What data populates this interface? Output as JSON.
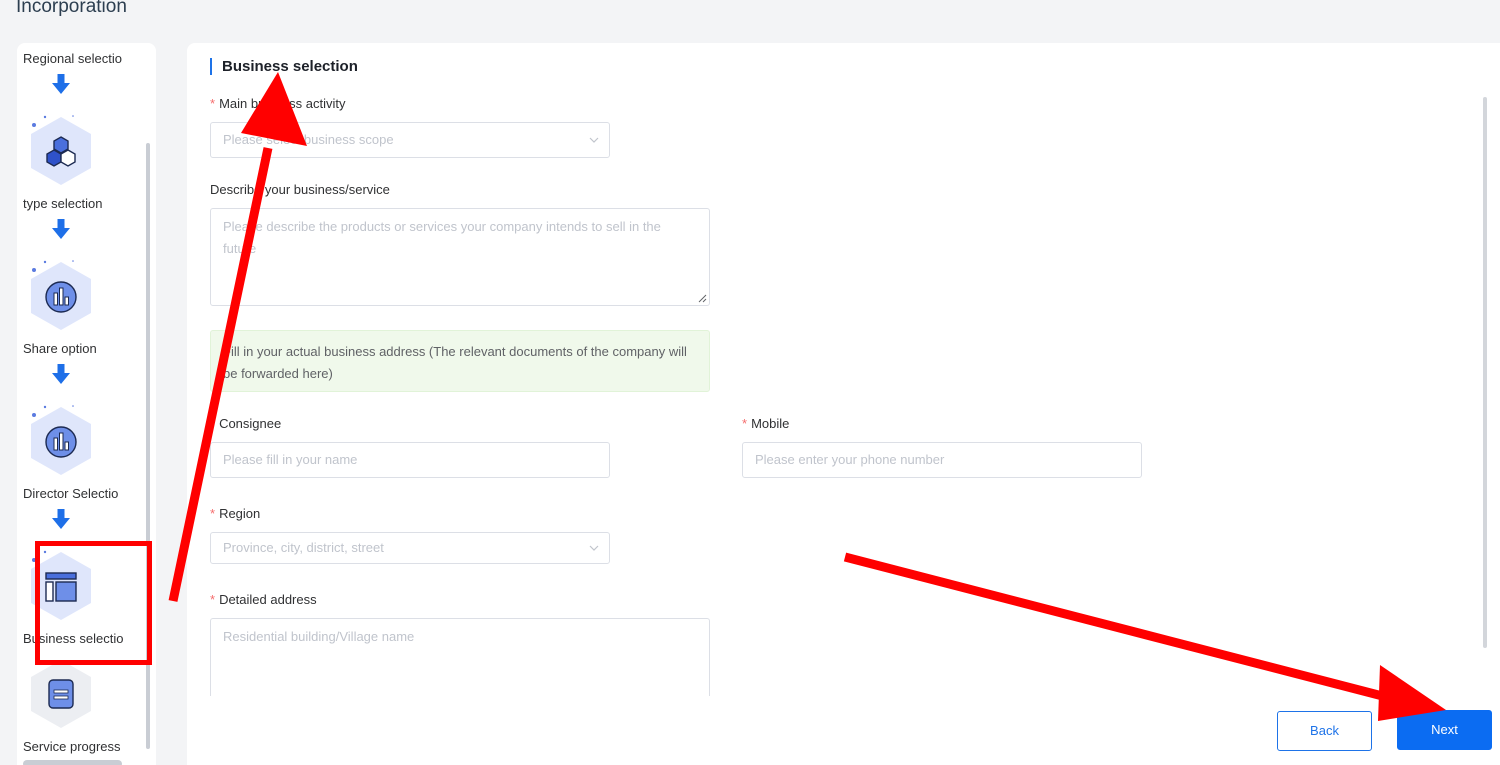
{
  "page": {
    "title": "Incorporation"
  },
  "sidebar": {
    "steps": [
      {
        "label": "Regional selectio",
        "icon": "regional-icon"
      },
      {
        "label": "type selection",
        "icon": "hexagons-icon"
      },
      {
        "label": "Share option",
        "icon": "bar-chart-icon"
      },
      {
        "label": "Director Selectio",
        "icon": "bar-chart-icon"
      },
      {
        "label": "Business selectio",
        "icon": "layout-icon",
        "active": true
      },
      {
        "label": "Service progress",
        "icon": "document-icon"
      }
    ]
  },
  "form": {
    "section_title": "Business selection",
    "main_activity": {
      "label": "Main business activity",
      "placeholder": "Please select business scope",
      "required": true
    },
    "describe": {
      "label": "Describe your business/service",
      "placeholder": "Please describe the products or services your company intends to sell in the future"
    },
    "notice": "Fill in your actual business address (The relevant documents of the company will be forwarded here)",
    "consignee": {
      "label": "Consignee",
      "placeholder": "Please fill in your name",
      "required": true
    },
    "mobile": {
      "label": "Mobile",
      "placeholder": "Please enter your phone number",
      "required": true
    },
    "region": {
      "label": "Region",
      "placeholder": "Province, city, district, street",
      "required": true
    },
    "address": {
      "label": "Detailed address",
      "placeholder": "Residential building/Village name",
      "required": true
    }
  },
  "buttons": {
    "back": "Back",
    "next": "Next"
  },
  "colors": {
    "primary": "#0b6cf2",
    "annotation": "#ff0000",
    "required": "#f56c6c",
    "notice_bg": "#f0f9eb"
  }
}
